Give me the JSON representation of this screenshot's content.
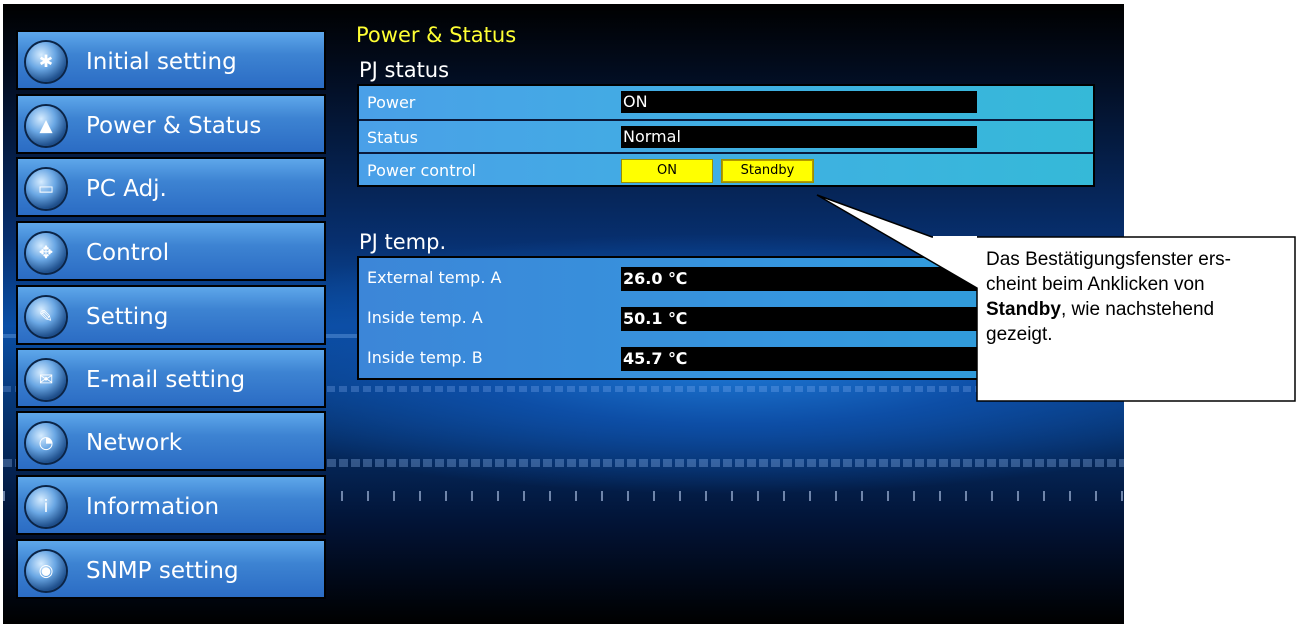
{
  "sidebar": {
    "items": [
      {
        "label": "Initial setting",
        "icon": "initial-setting-icon",
        "glyph": "✱"
      },
      {
        "label": "Power & Status",
        "icon": "power-status-icon",
        "glyph": "▲"
      },
      {
        "label": "PC Adj.",
        "icon": "pc-adj-icon",
        "glyph": "▭"
      },
      {
        "label": "Control",
        "icon": "control-icon",
        "glyph": "✥"
      },
      {
        "label": "Setting",
        "icon": "setting-icon",
        "glyph": "✎"
      },
      {
        "label": "E-mail setting",
        "icon": "email-icon",
        "glyph": "✉"
      },
      {
        "label": "Network",
        "icon": "network-icon",
        "glyph": "◔"
      },
      {
        "label": "Information",
        "icon": "information-icon",
        "glyph": "i"
      },
      {
        "label": "SNMP setting",
        "icon": "snmp-icon",
        "glyph": "◉"
      }
    ]
  },
  "main": {
    "section_title": "Power & Status",
    "pj_status": {
      "heading": "PJ status",
      "power_label": "Power",
      "power_value": "ON",
      "status_label": "Status",
      "status_value": "Normal",
      "control_label": "Power control",
      "on_button": "ON",
      "standby_button": "Standby"
    },
    "pj_temp": {
      "heading": "PJ temp.",
      "rows": [
        {
          "label": "External temp. A",
          "value": "26.0 ℃"
        },
        {
          "label": "Inside temp. A",
          "value": "50.1 ℃"
        },
        {
          "label": "Inside temp. B",
          "value": "45.7 ℃"
        }
      ]
    }
  },
  "callout": {
    "line1": "Das Bestätigungsfenster ers-",
    "line2": "cheint beim Anklicken von",
    "bold": "Standby",
    "line3_rest": ", wie nachstehend",
    "line4": "gezeigt."
  },
  "colors": {
    "accent_yellow": "#ffff00",
    "heading_yellow": "#ffff33",
    "nav_blue": "#3d83d2"
  }
}
